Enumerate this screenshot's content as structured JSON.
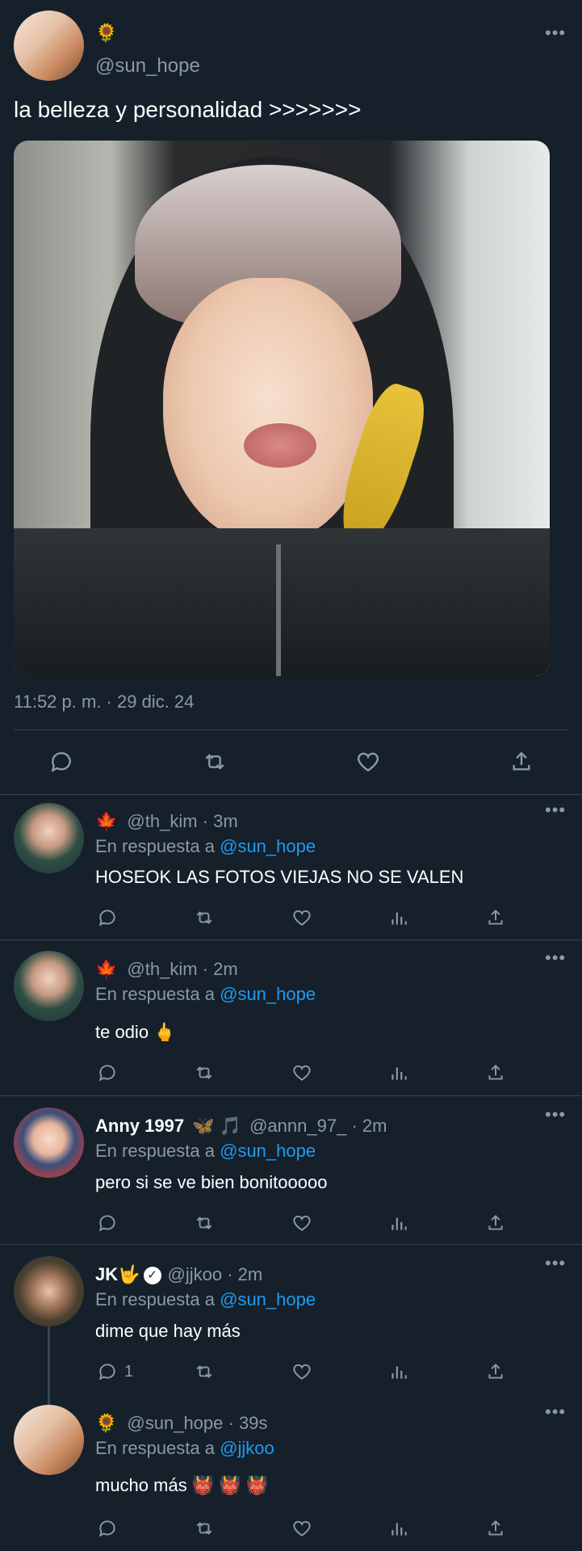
{
  "main_tweet": {
    "name_emoji": "🌻",
    "handle": "@sun_hope",
    "text": "la belleza y personalidad >>>>>>>",
    "timestamp": "11:52 p. m. · 29 dic. 24",
    "more_label": "•••"
  },
  "in_reply_label": "En respuesta a",
  "replies": [
    {
      "emoji": "🍁",
      "handle_time": "@th_kim · 3m",
      "reply_to": "@sun_hope",
      "text": "HOSEOK LAS FOTOS VIEJAS NO SE VALEN",
      "more_label": "•••"
    },
    {
      "emoji": "🍁",
      "handle_time": "@th_kim · 2m",
      "reply_to": "@sun_hope",
      "text": "te odio 🖕",
      "more_label": "•••"
    },
    {
      "name": "Anny 1997",
      "name_emoji": "🦋 🎵",
      "handle_time": "@annn_97_ · 2m",
      "reply_to": "@sun_hope",
      "text": "pero si se ve bien bonitooooo",
      "more_label": "•••"
    },
    {
      "name": "JK🤟",
      "verified": "✓",
      "handle_time": "@jjkoo · 2m",
      "reply_to": "@sun_hope",
      "text": "dime que hay más",
      "reply_count": "1",
      "more_label": "•••"
    },
    {
      "emoji": "🌻",
      "handle_time": "@sun_hope · 39s",
      "reply_to": "@jjkoo",
      "text": "mucho más 👹 👹 👹",
      "more_label": "•••"
    }
  ],
  "colors": {
    "background": "#15202b",
    "muted": "#8b98a5",
    "link": "#1d9bf0",
    "divider": "#38444d"
  }
}
